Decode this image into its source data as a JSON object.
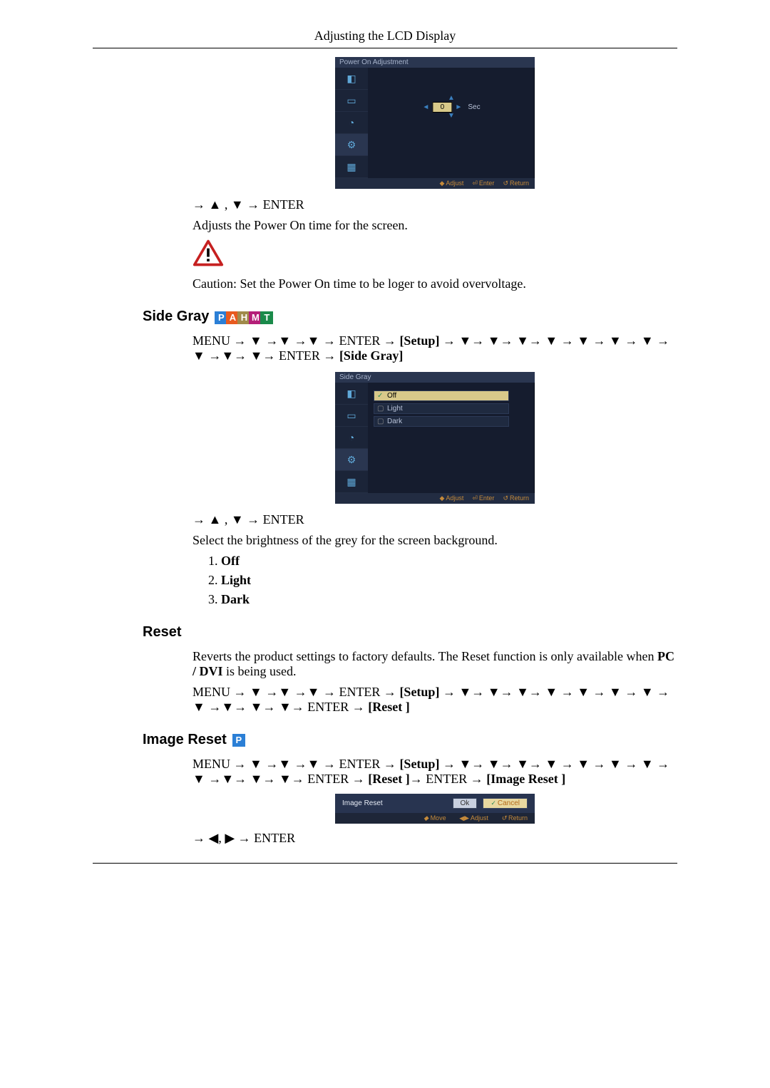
{
  "header": {
    "title": "Adjusting the LCD Display"
  },
  "osd1": {
    "title": "Power On Adjustment",
    "value": "0",
    "unit": "Sec",
    "footer": {
      "adjust": "Adjust",
      "enter": "Enter",
      "return": "Return"
    }
  },
  "poweron": {
    "nav": "→ ▲ , ▼ → ENTER",
    "desc": "Adjusts the Power On time for the screen.",
    "caution": "Caution: Set the Power On time to be loger to avoid overvoltage."
  },
  "sidegray": {
    "heading": "Side Gray",
    "tags": [
      "P",
      "A",
      "H",
      "M",
      "T"
    ],
    "menu_path_1": "MENU → ▼ →▼ →▼ → ENTER → ",
    "menu_path_setup": "[Setup]",
    "menu_path_2": " → ▼→ ▼→ ▼→ ▼ → ▼ → ▼ → ▼ → ▼ →▼→ ▼→ ENTER → ",
    "menu_path_target": "[Side Gray]",
    "osd": {
      "title": "Side Gray",
      "options": [
        "Off",
        "Light",
        "Dark"
      ],
      "footer": {
        "adjust": "Adjust",
        "enter": "Enter",
        "return": "Return"
      }
    },
    "nav": "→ ▲ , ▼ → ENTER",
    "desc": "Select the brightness of the grey for the screen background.",
    "list": [
      "Off",
      "Light",
      "Dark"
    ]
  },
  "reset": {
    "heading": "Reset",
    "desc_1": "Reverts the product settings to factory defaults. The Reset function is only available when ",
    "desc_bold": "PC / DVI",
    "desc_2": " is being used.",
    "path_1": "MENU → ▼ →▼ →▼ → ENTER → ",
    "path_setup": "[Setup]",
    "path_2": " → ▼→ ▼→ ▼→ ▼ → ▼ → ▼ → ▼ → ▼ →▼→ ▼→ ▼→ ENTER → ",
    "path_target": "[Reset ]"
  },
  "imagereset": {
    "heading": "Image Reset",
    "tag": "P",
    "path_1": "MENU → ▼ →▼ →▼ → ENTER → ",
    "path_setup": "[Setup]",
    "path_2": " → ▼→ ▼→ ▼→ ▼ → ▼ → ▼ → ▼ → ▼ →▼→ ▼→ ▼→ ENTER → ",
    "path_reset": "[Reset ]",
    "path_3": "→ ENTER → ",
    "path_target": "[Image Reset ]",
    "osd": {
      "title": "Image Reset",
      "ok": "Ok",
      "cancel": "Cancel",
      "footer": {
        "move": "Move",
        "adjust": "Adjust",
        "return": "Return"
      }
    },
    "nav": "→ ◀, ▶ → ENTER"
  }
}
